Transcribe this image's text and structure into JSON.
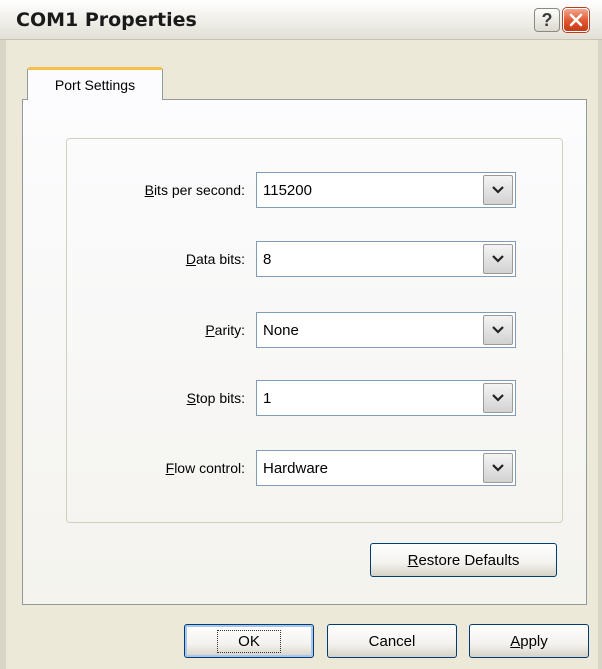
{
  "window": {
    "title": "COM1 Properties",
    "help_button": "?",
    "close_icon": "close-icon"
  },
  "tabs": [
    {
      "label": "Port Settings",
      "selected": true
    }
  ],
  "fields": [
    {
      "label_pre": "",
      "label_key": "B",
      "label_post": "its per second:",
      "value": "115200"
    },
    {
      "label_pre": "",
      "label_key": "D",
      "label_post": "ata bits:",
      "value": "8"
    },
    {
      "label_pre": "",
      "label_key": "P",
      "label_post": "arity:",
      "value": "None"
    },
    {
      "label_pre": "",
      "label_key": "S",
      "label_post": "top bits:",
      "value": "1"
    },
    {
      "label_pre": "",
      "label_key": "F",
      "label_post": "low control:",
      "value": "Hardware"
    }
  ],
  "buttons": {
    "restore_key": "R",
    "restore_rest": "estore Defaults",
    "ok": "OK",
    "cancel": "Cancel",
    "apply_key": "A",
    "apply_rest": "pply"
  },
  "colors": {
    "window_bg": "#ece9d8",
    "tab_highlight": "#f5c04d",
    "close_button": "#e1552f",
    "combo_border": "#7f9db9"
  }
}
